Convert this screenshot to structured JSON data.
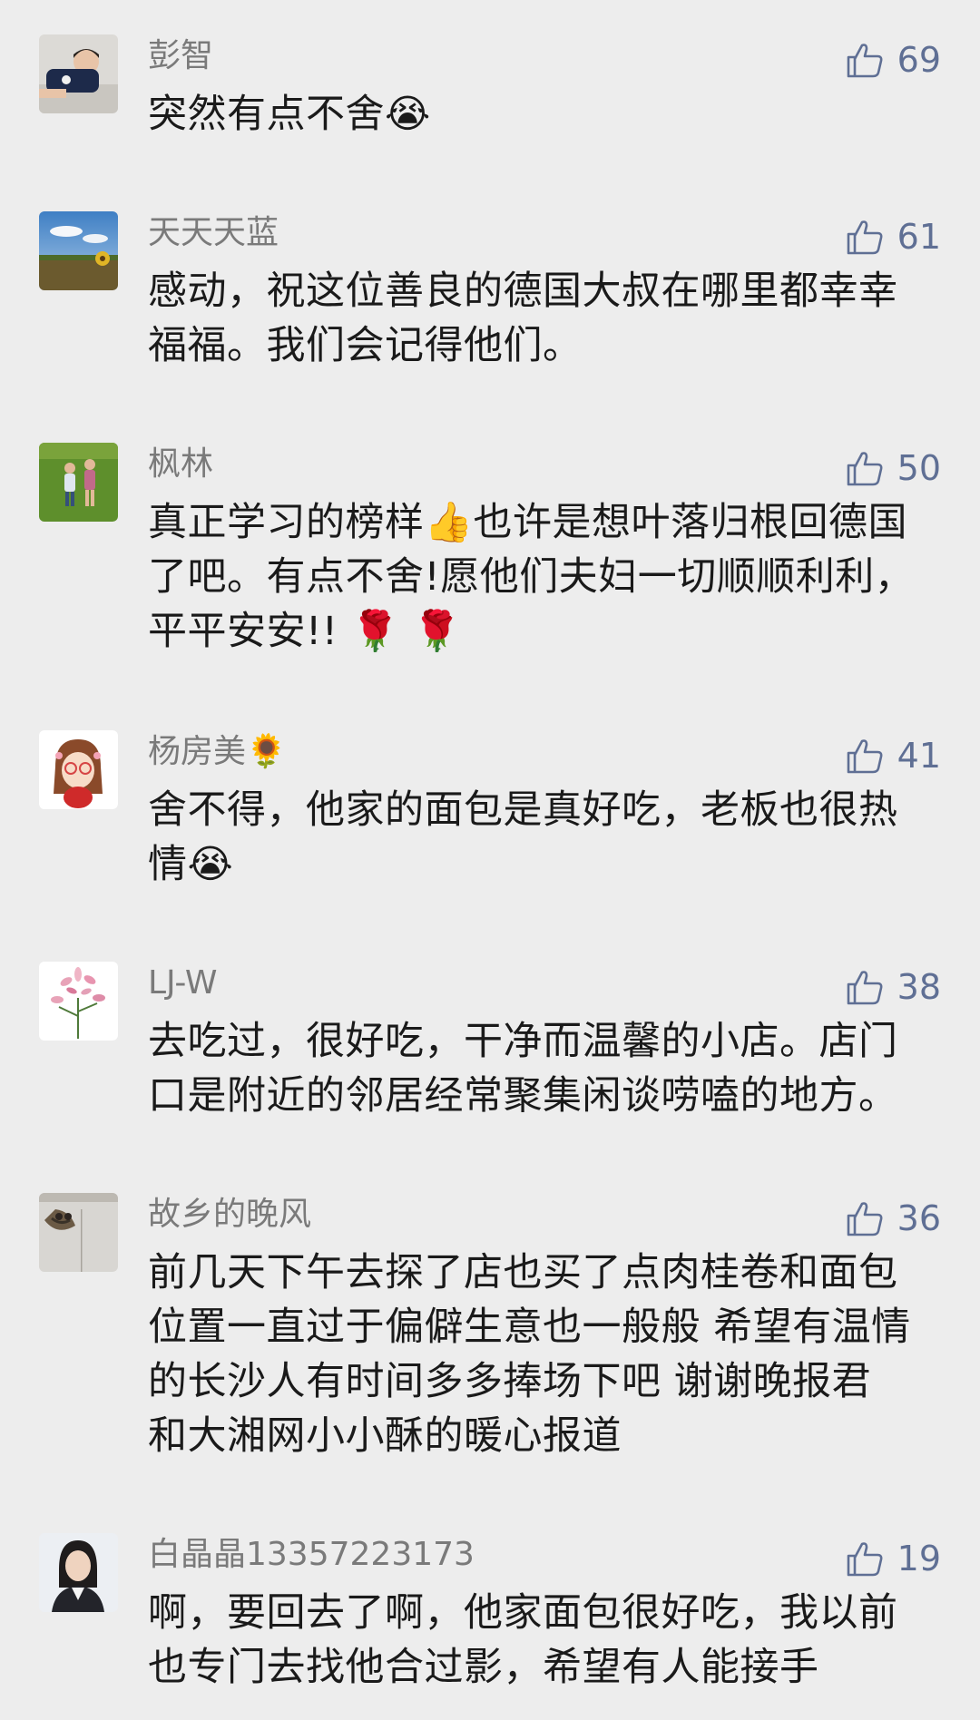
{
  "comments": [
    {
      "nickname": "彭智",
      "likes": "69",
      "avatar": "boy-photo-avatar",
      "lines": [
        "突然有点不舍😭"
      ]
    },
    {
      "nickname": "天天天蓝",
      "likes": "61",
      "avatar": "sunflower-field-avatar",
      "lines": [
        "感动，祝这位善良的德国大叔在哪里都幸幸",
        "福福。我们会记得他们。"
      ]
    },
    {
      "nickname": "枫林",
      "likes": "50",
      "avatar": "children-on-grass-avatar",
      "lines": [
        "真正学习的榜样👍也许是想叶落归根回德国",
        "了吧。有点不舍!愿他们夫妇一切顺顺利利，",
        "平平安安!! 🌹 🌹"
      ]
    },
    {
      "nickname": "杨房美🌻",
      "likes": "41",
      "avatar": "cartoon-girl-avatar",
      "lines": [
        "舍不得，他家的面包是真好吃，老板也很热",
        "情😭"
      ]
    },
    {
      "nickname": "LJ-W",
      "likes": "38",
      "avatar": "pink-flower-avatar",
      "lines": [
        "去吃过，很好吃，干净而温馨的小店。店门",
        "口是附近的邻居经常聚集闲谈唠嗑的地方。"
      ]
    },
    {
      "nickname": "故乡的晚风",
      "likes": "36",
      "avatar": "swallow-nest-avatar",
      "lines": [
        "前几天下午去探了店也买了点肉桂卷和面包",
        "位置一直过于偏僻生意也一般般  希望有温情",
        "的长沙人有时间多多捧场下吧   谢谢晚报君",
        "和大湘网小小酥的暖心报道"
      ]
    },
    {
      "nickname": "白晶晶13357223173",
      "likes": "19",
      "avatar": "woman-portrait-avatar",
      "lines": [
        "啊，要回去了啊，他家面包很好吃，我以前",
        "也专门去找他合过影，希望有人能接手"
      ]
    }
  ],
  "icons": {
    "like": "thumbs-up-icon"
  },
  "colors": {
    "background": "#ededed",
    "nickname": "#7a7a7a",
    "like": "#5f6f94",
    "text": "#1a1a1a"
  }
}
